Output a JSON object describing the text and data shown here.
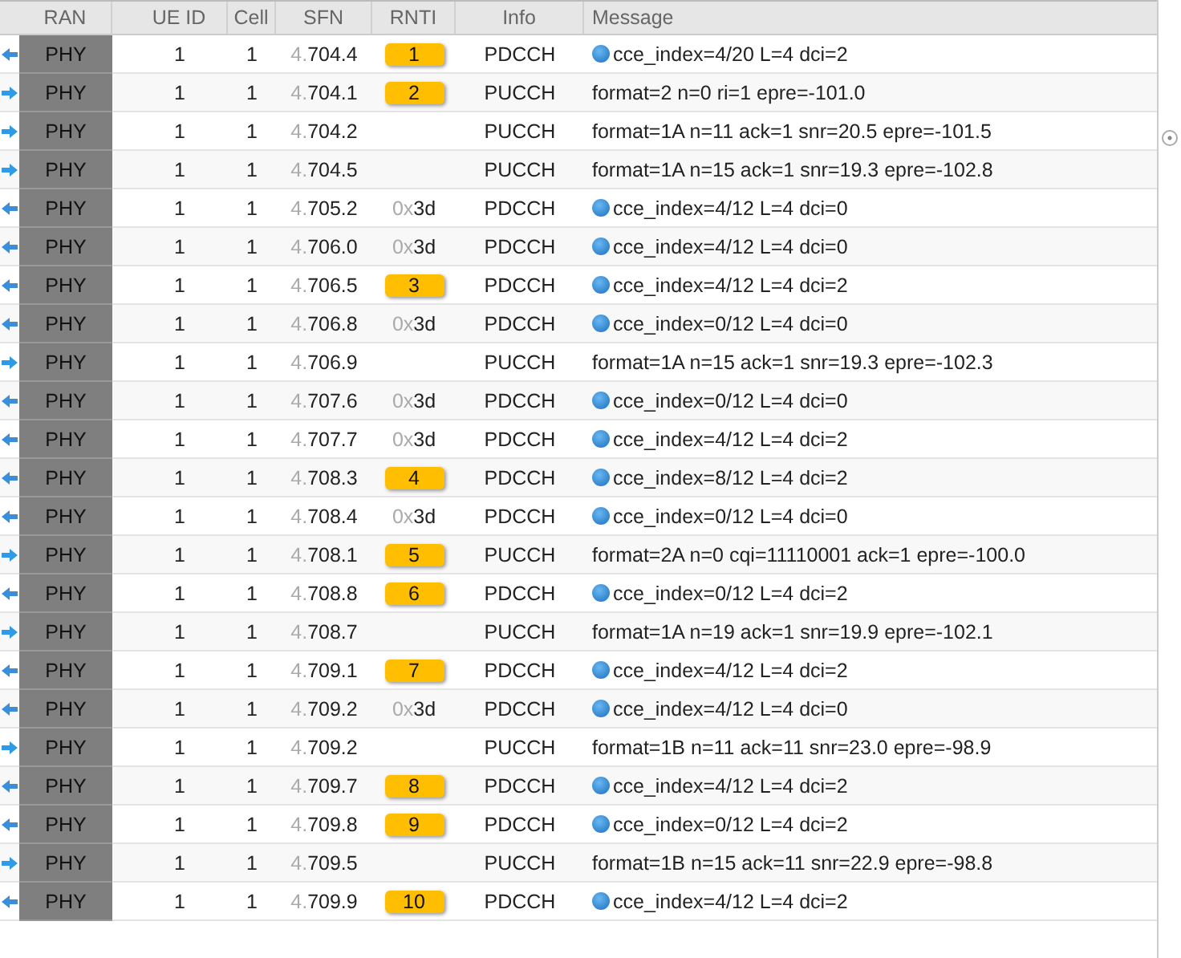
{
  "table": {
    "columns": [
      "RAN",
      "UE ID",
      "Cell",
      "SFN",
      "RNTI",
      "Info",
      "Message"
    ],
    "rows": [
      {
        "kind": "downlink",
        "ran": "PHY",
        "ue_id": "1",
        "cell": "1",
        "sfn": "4.704.4",
        "rnti": {
          "kind": "badge",
          "text": "1"
        },
        "info": "PDCCH",
        "info_icon": true,
        "message": "cce_index=4/20 L=4 dci=2"
      },
      {
        "kind": "uplink",
        "ran": "PHY",
        "ue_id": "1",
        "cell": "1",
        "sfn": "4.704.1",
        "rnti": {
          "kind": "badge",
          "text": "2"
        },
        "info": "PUCCH",
        "info_icon": false,
        "message": "format=2 n=0 ri=1 epre=-101.0"
      },
      {
        "kind": "uplink",
        "ran": "PHY",
        "ue_id": "1",
        "cell": "1",
        "sfn": "4.704.2",
        "info": "PUCCH",
        "info_icon": false,
        "message": "format=1A n=11 ack=1 snr=20.5 epre=-101.5"
      },
      {
        "kind": "uplink",
        "ran": "PHY",
        "ue_id": "1",
        "cell": "1",
        "sfn": "4.704.5",
        "info": "PUCCH",
        "info_icon": false,
        "message": "format=1A n=15 ack=1 snr=19.3 epre=-102.8"
      },
      {
        "kind": "downlink",
        "ran": "PHY",
        "ue_id": "1",
        "cell": "1",
        "sfn": "4.705.2",
        "rnti": {
          "kind": "hex",
          "text": "0x3d"
        },
        "info": "PDCCH",
        "info_icon": true,
        "message": "cce_index=4/12 L=4 dci=0"
      },
      {
        "kind": "downlink",
        "ran": "PHY",
        "ue_id": "1",
        "cell": "1",
        "sfn": "4.706.0",
        "rnti": {
          "kind": "hex",
          "text": "0x3d"
        },
        "info": "PDCCH",
        "info_icon": true,
        "message": "cce_index=4/12 L=4 dci=0"
      },
      {
        "kind": "downlink",
        "ran": "PHY",
        "ue_id": "1",
        "cell": "1",
        "sfn": "4.706.5",
        "rnti": {
          "kind": "badge",
          "text": "3"
        },
        "info": "PDCCH",
        "info_icon": true,
        "message": "cce_index=4/12 L=4 dci=2"
      },
      {
        "kind": "downlink",
        "ran": "PHY",
        "ue_id": "1",
        "cell": "1",
        "sfn": "4.706.8",
        "rnti": {
          "kind": "hex",
          "text": "0x3d"
        },
        "info": "PDCCH",
        "info_icon": true,
        "message": "cce_index=0/12 L=4 dci=0"
      },
      {
        "kind": "uplink",
        "ran": "PHY",
        "ue_id": "1",
        "cell": "1",
        "sfn": "4.706.9",
        "info": "PUCCH",
        "info_icon": false,
        "message": "format=1A n=15 ack=1 snr=19.3 epre=-102.3"
      },
      {
        "kind": "downlink",
        "ran": "PHY",
        "ue_id": "1",
        "cell": "1",
        "sfn": "4.707.6",
        "rnti": {
          "kind": "hex",
          "text": "0x3d"
        },
        "info": "PDCCH",
        "info_icon": true,
        "message": "cce_index=0/12 L=4 dci=0"
      },
      {
        "kind": "downlink",
        "ran": "PHY",
        "ue_id": "1",
        "cell": "1",
        "sfn": "4.707.7",
        "rnti": {
          "kind": "hex",
          "text": "0x3d"
        },
        "info": "PDCCH",
        "info_icon": true,
        "message": "cce_index=4/12 L=4 dci=2"
      },
      {
        "kind": "downlink",
        "ran": "PHY",
        "ue_id": "1",
        "cell": "1",
        "sfn": "4.708.3",
        "rnti": {
          "kind": "badge",
          "text": "4"
        },
        "info": "PDCCH",
        "info_icon": true,
        "message": "cce_index=8/12 L=4 dci=2"
      },
      {
        "kind": "downlink",
        "ran": "PHY",
        "ue_id": "1",
        "cell": "1",
        "sfn": "4.708.4",
        "rnti": {
          "kind": "hex",
          "text": "0x3d"
        },
        "info": "PDCCH",
        "info_icon": true,
        "message": "cce_index=0/12 L=4 dci=0"
      },
      {
        "kind": "uplink",
        "ran": "PHY",
        "ue_id": "1",
        "cell": "1",
        "sfn": "4.708.1",
        "rnti": {
          "kind": "badge",
          "text": "5"
        },
        "info": "PUCCH",
        "info_icon": false,
        "message": "format=2A n=0 cqi=11110001 ack=1 epre=-100.0"
      },
      {
        "kind": "downlink",
        "ran": "PHY",
        "ue_id": "1",
        "cell": "1",
        "sfn": "4.708.8",
        "rnti": {
          "kind": "badge",
          "text": "6"
        },
        "info": "PDCCH",
        "info_icon": true,
        "message": "cce_index=0/12 L=4 dci=2"
      },
      {
        "kind": "uplink",
        "ran": "PHY",
        "ue_id": "1",
        "cell": "1",
        "sfn": "4.708.7",
        "info": "PUCCH",
        "info_icon": false,
        "message": "format=1A n=19 ack=1 snr=19.9 epre=-102.1"
      },
      {
        "kind": "downlink",
        "ran": "PHY",
        "ue_id": "1",
        "cell": "1",
        "sfn": "4.709.1",
        "rnti": {
          "kind": "badge",
          "text": "7"
        },
        "info": "PDCCH",
        "info_icon": true,
        "message": "cce_index=4/12 L=4 dci=2"
      },
      {
        "kind": "downlink",
        "ran": "PHY",
        "ue_id": "1",
        "cell": "1",
        "sfn": "4.709.2",
        "rnti": {
          "kind": "hex",
          "text": "0x3d"
        },
        "info": "PDCCH",
        "info_icon": true,
        "message": "cce_index=4/12 L=4 dci=0"
      },
      {
        "kind": "uplink",
        "ran": "PHY",
        "ue_id": "1",
        "cell": "1",
        "sfn": "4.709.2",
        "info": "PUCCH",
        "info_icon": false,
        "message": "format=1B n=11 ack=11 snr=23.0 epre=-98.9"
      },
      {
        "kind": "downlink",
        "ran": "PHY",
        "ue_id": "1",
        "cell": "1",
        "sfn": "4.709.7",
        "rnti": {
          "kind": "badge",
          "text": "8"
        },
        "info": "PDCCH",
        "info_icon": true,
        "message": "cce_index=4/12 L=4 dci=2"
      },
      {
        "kind": "downlink",
        "ran": "PHY",
        "ue_id": "1",
        "cell": "1",
        "sfn": "4.709.8",
        "rnti": {
          "kind": "badge",
          "text": "9"
        },
        "info": "PDCCH",
        "info_icon": true,
        "message": "cce_index=0/12 L=4 dci=2"
      },
      {
        "kind": "uplink",
        "ran": "PHY",
        "ue_id": "1",
        "cell": "1",
        "sfn": "4.709.5",
        "info": "PUCCH",
        "info_icon": false,
        "message": "format=1B n=15 ack=11 snr=22.9 epre=-98.8"
      },
      {
        "kind": "downlink",
        "ran": "PHY",
        "ue_id": "1",
        "cell": "1",
        "sfn": "4.709.9",
        "rnti": {
          "kind": "badge",
          "text": "10"
        },
        "info": "PDCCH",
        "info_icon": true,
        "message": "cce_index=4/12 L=4 dci=2"
      }
    ]
  }
}
